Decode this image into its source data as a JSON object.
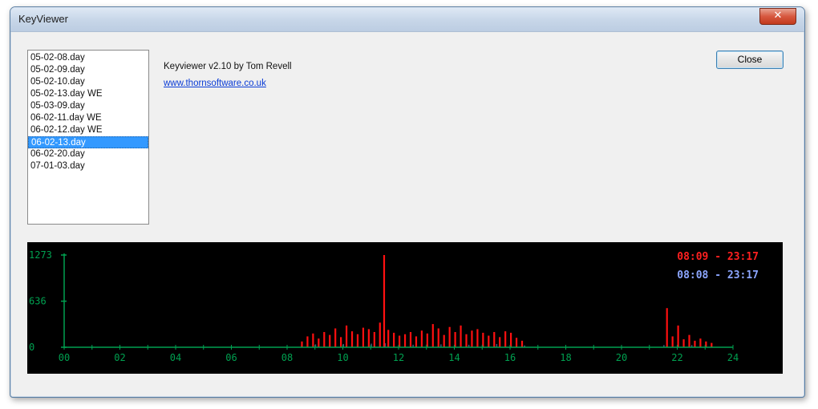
{
  "window": {
    "title": "KeyViewer",
    "close_glyph": "✕"
  },
  "file_list": {
    "items": [
      "05-02-08.day",
      "05-02-09.day",
      "05-02-10.day",
      "05-02-13.day WE",
      "05-03-09.day",
      "06-02-11.day WE",
      "06-02-12.day WE",
      "06-02-13.day",
      "06-02-20.day",
      "07-01-03.day"
    ],
    "selected_index": 7
  },
  "about": {
    "version_text": "Keyviewer v2.10 by Tom Revell",
    "link_text": "www.thornsoftware.co.uk"
  },
  "buttons": {
    "close_label": "Close"
  },
  "colors": {
    "axis": "#00a050",
    "bars": "#ff1010",
    "range_red": "#ff2020",
    "range_blue": "#8ca6ff"
  },
  "chart_data": {
    "type": "bar",
    "xlim": [
      0,
      24
    ],
    "ylim": [
      0,
      1273
    ],
    "x_tick_labels": [
      "00",
      "02",
      "04",
      "06",
      "08",
      "10",
      "12",
      "14",
      "16",
      "18",
      "20",
      "22",
      "24"
    ],
    "y_tick_labels": [
      "1273",
      "636",
      "0"
    ],
    "y_tick_values": [
      1273,
      636,
      0
    ],
    "legend": [
      "08:09 - 23:17",
      "08:08 - 23:17"
    ],
    "series": [
      {
        "x": [
          8.5,
          8.7,
          8.9,
          9.1,
          9.3,
          9.5,
          9.7,
          9.9,
          10.1,
          10.3,
          10.5,
          10.7,
          10.9,
          11.1,
          11.3,
          11.45,
          11.6,
          11.8,
          12.0,
          12.2,
          12.4,
          12.6,
          12.8,
          13.0,
          13.2,
          13.4,
          13.6,
          13.8,
          14.0,
          14.2,
          14.4,
          14.6,
          14.8,
          15.0,
          15.2,
          15.4,
          15.6,
          15.8,
          16.0,
          16.2,
          16.4,
          21.6,
          21.8,
          22.0,
          22.2,
          22.4,
          22.6,
          22.8,
          23.0,
          23.2
        ],
        "y": [
          80,
          150,
          190,
          120,
          210,
          170,
          260,
          140,
          300,
          220,
          180,
          270,
          250,
          210,
          340,
          1273,
          240,
          200,
          160,
          180,
          210,
          150,
          230,
          190,
          320,
          260,
          170,
          280,
          210,
          300,
          180,
          230,
          250,
          200,
          160,
          210,
          140,
          220,
          200,
          130,
          90,
          540,
          150,
          300,
          110,
          170,
          90,
          120,
          80,
          60
        ]
      },
      {
        "x": [
          8.5,
          9.0,
          9.5,
          10.0,
          10.5,
          11.0,
          11.5,
          12.0,
          12.5,
          13.0,
          13.5,
          14.0,
          14.5,
          15.0,
          15.5,
          16.0,
          16.5,
          21.5,
          22.0,
          22.5,
          23.0
        ],
        "y": [
          30,
          40,
          35,
          45,
          40,
          50,
          55,
          40,
          35,
          45,
          40,
          50,
          35,
          40,
          45,
          35,
          25,
          30,
          40,
          30,
          25
        ]
      }
    ]
  }
}
